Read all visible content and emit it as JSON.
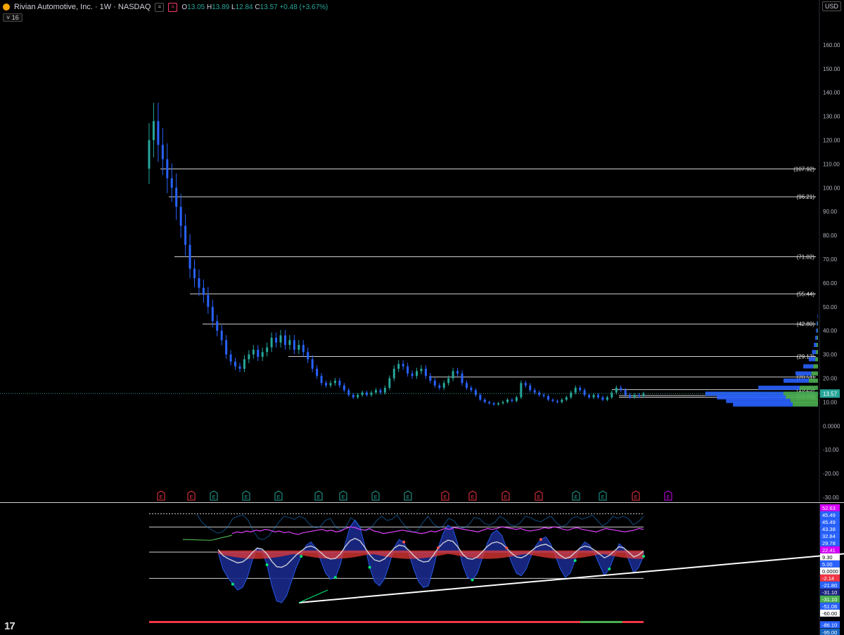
{
  "header": {
    "title": "Rivian Automotive, Inc. · 1W · NASDAQ",
    "ohlc": {
      "o_label": "O",
      "o": "13.05",
      "h_label": "H",
      "h": "13.89",
      "l_label": "L",
      "l": "12.84",
      "c_label": "C",
      "c": "13.57",
      "change": "+0.48 (+3.67%)"
    },
    "interval_badge": "16",
    "currency": "USD"
  },
  "colors": {
    "background": "#000000",
    "candle_up": "#26a69a",
    "candle_down": "#2962ff",
    "volume_profile_blue": "#2962ff",
    "volume_profile_green": "#4caf50",
    "earnings_red": "#f23645",
    "earnings_green": "#26a69a",
    "earnings_purple": "#d500f9",
    "oscillator_fill": "#1a2a8a",
    "oscillator_red": "#e53935",
    "oscillator_pink": "#e040fb",
    "price_line": "#26a69a"
  },
  "chart_data": [
    {
      "type": "candlestick",
      "title": "Rivian Automotive, Inc. · 1W · NASDAQ",
      "interval": "1W",
      "y_ticks": [
        160,
        150,
        140,
        130,
        120,
        110,
        100,
        90,
        80,
        70,
        60,
        50,
        40,
        30,
        20,
        10,
        0,
        -10,
        -20,
        -30
      ],
      "y_tick_labels": [
        "160.00",
        "150.00",
        "140.00",
        "130.00",
        "120.00",
        "110.00",
        "100.00",
        "90.00",
        "80.00",
        "70.00",
        "60.00",
        "50.00",
        "40.00",
        "30.00",
        "20.00",
        "10.00",
        "0.0000",
        "-10.00",
        "-20.00",
        "-30.00"
      ],
      "ylim": [
        -30,
        170
      ],
      "last_price": 13.57,
      "last_price_label": "13.57",
      "close_series": [
        120,
        128,
        118,
        112,
        104,
        100,
        92,
        84,
        76,
        66,
        62,
        58,
        55,
        50,
        44,
        40,
        36,
        30,
        27,
        25,
        24,
        28,
        30,
        32,
        29,
        31,
        33,
        37,
        35,
        38,
        34,
        36,
        32,
        34,
        31,
        28,
        24,
        21,
        18,
        17,
        18,
        19,
        17,
        15,
        13,
        12,
        13,
        14,
        13,
        14,
        15,
        14,
        16,
        20,
        24,
        26,
        25,
        22,
        21,
        23,
        24,
        21,
        19,
        17,
        16,
        18,
        20,
        23,
        22,
        18,
        16,
        15,
        13,
        11,
        10,
        9.5,
        9,
        9.5,
        10,
        11,
        10.5,
        12,
        18,
        17,
        15,
        14,
        13,
        12.5,
        11,
        10.5,
        10,
        11,
        12,
        14,
        16,
        15,
        13,
        12,
        13,
        12,
        11,
        12,
        14,
        16,
        15,
        13,
        12,
        13,
        12.5,
        13.57
      ],
      "horizontal_levels": [
        107.92,
        96.21,
        71.02,
        55.44,
        42.8,
        29.13,
        20.51,
        15.25,
        12.74,
        12.05
      ],
      "horizontal_level_labels": [
        "(107.92)",
        "(96.21)",
        "(71.02)",
        "(55.44)",
        "(42.80)",
        "(29.13)",
        "(20.51)",
        "(15.25)",
        "(12.74)",
        "(12.05)"
      ],
      "volume_profile": [
        {
          "price": 46,
          "blue": 1,
          "green": 0
        },
        {
          "price": 43,
          "blue": 2,
          "green": 1
        },
        {
          "price": 40,
          "blue": 3,
          "green": 1
        },
        {
          "price": 37,
          "blue": 4,
          "green": 2
        },
        {
          "price": 34,
          "blue": 6,
          "green": 3
        },
        {
          "price": 31,
          "blue": 9,
          "green": 4
        },
        {
          "price": 28,
          "blue": 14,
          "green": 6
        },
        {
          "price": 25,
          "blue": 22,
          "green": 10
        },
        {
          "price": 22,
          "blue": 35,
          "green": 14
        },
        {
          "price": 19,
          "blue": 55,
          "green": 20
        },
        {
          "price": 16,
          "blue": 90,
          "green": 40
        },
        {
          "price": 13.5,
          "blue": 170,
          "green": 75
        },
        {
          "price": 12,
          "blue": 150,
          "green": 70
        },
        {
          "price": 10.5,
          "blue": 140,
          "green": 60
        },
        {
          "price": 9,
          "blue": 130,
          "green": 55
        }
      ],
      "earnings_markers": [
        {
          "label": "E",
          "type": "red"
        },
        {
          "label": "E",
          "type": "red"
        },
        {
          "label": "E",
          "type": "green"
        },
        {
          "label": "E",
          "type": "green"
        },
        {
          "label": "E",
          "type": "green"
        },
        {
          "label": "E",
          "type": "green"
        },
        {
          "label": "E",
          "type": "green"
        },
        {
          "label": "E",
          "type": "green"
        },
        {
          "label": "E",
          "type": "green"
        },
        {
          "label": "E",
          "type": "red"
        },
        {
          "label": "E",
          "type": "red"
        },
        {
          "label": "E",
          "type": "red"
        },
        {
          "label": "E",
          "type": "red"
        },
        {
          "label": "E",
          "type": "green"
        },
        {
          "label": "E",
          "type": "green"
        },
        {
          "label": "E",
          "type": "red"
        },
        {
          "label": "E",
          "type": "purple"
        }
      ],
      "grid": false
    },
    {
      "type": "area",
      "title": "",
      "y_tick_labels": [
        "52.63",
        "45.49",
        "45.49",
        "43.38",
        "32.84",
        "29.78",
        "22.41",
        "9.30",
        "5.00",
        "0.0000",
        "-2.14",
        "-21.80",
        "-31.10",
        "-31.10",
        "-51.06",
        "-60.00",
        "-86.10",
        "-95.00"
      ],
      "y_tick_colors": [
        "#d500f9",
        "#2962ff",
        "#2962ff",
        "#2962ff",
        "#2962ff",
        "#2962ff",
        "#d500f9",
        "#ffffff",
        "#2962ff",
        "#ffffff",
        "#f23645",
        "#2962ff",
        "#1a237e",
        "#4caf50",
        "#2962ff",
        "#ffffff",
        "#2962ff",
        "#1565c0"
      ],
      "ylim": [
        -95,
        55
      ],
      "reference_levels": [
        45.49,
        29.78,
        0,
        -31.1
      ],
      "fill_series": [
        0,
        -20,
        -30,
        -38,
        -45,
        -42,
        -30,
        -10,
        5,
        2,
        -15,
        -40,
        -58,
        -60,
        -52,
        -35,
        -18,
        -5,
        8,
        12,
        5,
        -10,
        -25,
        -32,
        -30,
        -15,
        10,
        30,
        38,
        30,
        8,
        -18,
        -35,
        -40,
        -32,
        -15,
        5,
        15,
        12,
        -2,
        -20,
        -35,
        -42,
        -40,
        -20,
        5,
        22,
        32,
        28,
        10,
        -15,
        -30,
        -33,
        -25,
        -8,
        10,
        22,
        26,
        20,
        5,
        -12,
        -25,
        -28,
        -20,
        -5,
        8,
        15,
        18,
        10,
        -5,
        -20,
        -30,
        -25,
        -10,
        5,
        12,
        8,
        -2,
        -15,
        -28,
        -20,
        -5,
        10,
        5,
        -10,
        -25,
        -18,
        -5
      ],
      "pink_series": [
        22,
        24,
        23,
        25,
        24,
        26,
        25,
        27,
        26,
        24,
        25,
        23,
        24,
        22,
        21,
        23,
        24,
        25,
        26,
        27,
        25,
        26,
        24,
        25,
        28,
        30,
        29,
        27,
        26,
        28,
        25,
        24,
        22,
        23,
        24,
        25,
        26,
        25,
        24,
        23,
        22,
        23,
        25,
        24,
        26,
        28,
        27,
        29,
        28,
        27,
        26,
        25,
        24,
        26,
        28,
        27,
        28,
        30,
        29,
        28,
        27,
        28,
        26,
        25,
        26,
        27,
        29,
        28,
        30,
        29,
        27,
        26,
        28,
        29,
        27,
        26,
        25,
        24,
        26,
        28,
        27,
        26,
        25,
        24,
        25,
        26,
        28,
        27
      ],
      "trendline": {
        "x": [
          0.23,
          1.0
        ],
        "y": [
          -60,
          0
        ]
      },
      "grid": false
    }
  ]
}
